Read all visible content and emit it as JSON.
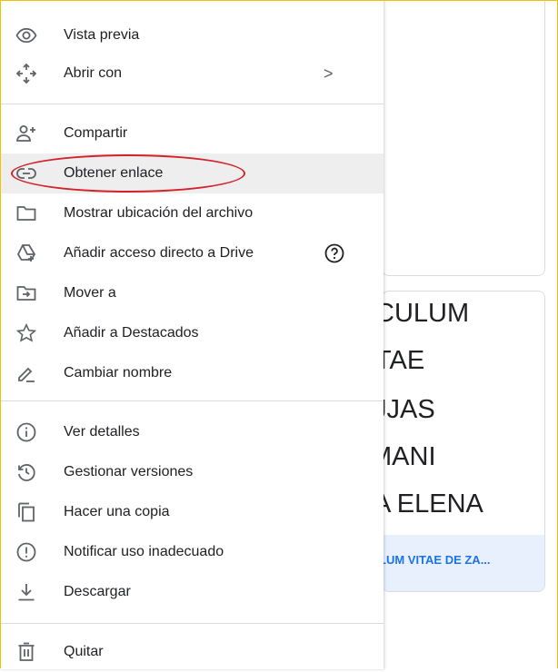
{
  "menu": {
    "items": [
      {
        "label": "Vista previa",
        "icon": "eye-icon"
      },
      {
        "label": "Abrir con",
        "icon": "move-arrows-icon",
        "chevron": ">"
      },
      {
        "label": "Compartir",
        "icon": "add-person-icon"
      },
      {
        "label": "Obtener enlace",
        "icon": "link-icon",
        "active": true
      },
      {
        "label": "Mostrar ubicación del archivo",
        "icon": "folder-icon"
      },
      {
        "label": "Añadir acceso directo a Drive",
        "icon": "drive-shortcut-icon"
      },
      {
        "label": "Mover a",
        "icon": "move-to-folder-icon"
      },
      {
        "label": "Añadir a Destacados",
        "icon": "star-icon"
      },
      {
        "label": "Cambiar nombre",
        "icon": "pencil-icon"
      },
      {
        "label": "Ver detalles",
        "icon": "info-icon"
      },
      {
        "label": "Gestionar versiones",
        "icon": "history-icon"
      },
      {
        "label": "Hacer una copia",
        "icon": "copy-icon"
      },
      {
        "label": "Notificar uso inadecuado",
        "icon": "report-icon"
      },
      {
        "label": "Descargar",
        "icon": "download-icon"
      },
      {
        "label": "Quitar",
        "icon": "trash-icon"
      }
    ],
    "help_icon": "help-icon"
  },
  "file_card": {
    "thumbnail_lines": [
      "CULUM",
      "TAE",
      "JJAS",
      "MANI",
      "A ELENA"
    ],
    "title": "LUM VITAE DE ZA..."
  },
  "colors": {
    "active_bg": "#eeeeee",
    "highlight": "#d2232a",
    "link_blue": "#1a73e8",
    "footer_bg": "#e8f0fe"
  }
}
